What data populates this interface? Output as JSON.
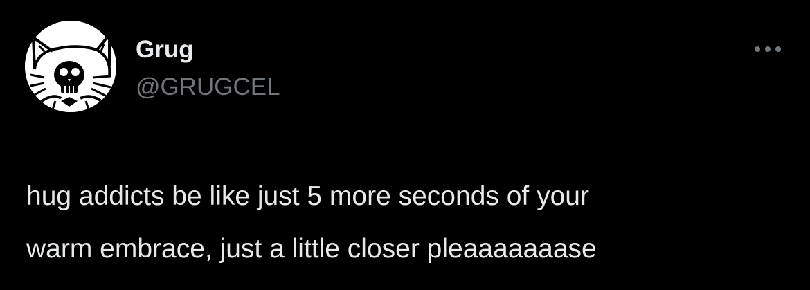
{
  "author": {
    "display_name": "Grug",
    "handle": "@GRUGCEL",
    "avatar_icon": "cat-skull-drawing-icon"
  },
  "actions": {
    "more_icon": "ellipsis-icon"
  },
  "tweet": {
    "lines": [
      "hug addicts be like just 5 more seconds of your",
      "warm embrace, just a little closer pleaaaaaaase"
    ]
  },
  "colors": {
    "background": "#000000",
    "primary_text": "#e7e9ea",
    "secondary_text": "#71767b"
  }
}
